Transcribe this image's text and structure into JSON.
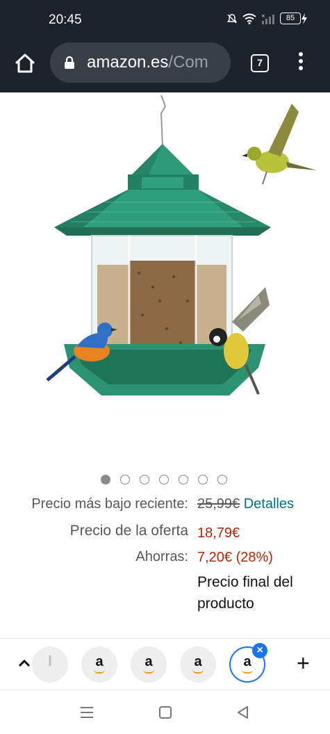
{
  "status": {
    "time": "20:45",
    "battery": "85"
  },
  "browser": {
    "url_domain": "amazon.es",
    "url_path": "/Com",
    "tab_count": "7"
  },
  "carousel": {
    "total": 7,
    "active_index": 0
  },
  "pricing": {
    "lowest_label": "Precio más bajo reciente:",
    "lowest_value": "25,99€",
    "details_link": "Detalles",
    "offer_label": "Precio de la oferta",
    "offer_value": "18,79€",
    "savings_label": "Ahorras:",
    "savings_value": "7,20€ (28%)",
    "final_note": "Precio final del producto"
  },
  "tabstrip": {
    "tab_letter": "a",
    "partial_tab_letter": "l"
  },
  "colors": {
    "chrome_bg": "#1e232b",
    "link": "#007185",
    "price_red": "#b12704",
    "active_tab": "#1a73e8"
  }
}
